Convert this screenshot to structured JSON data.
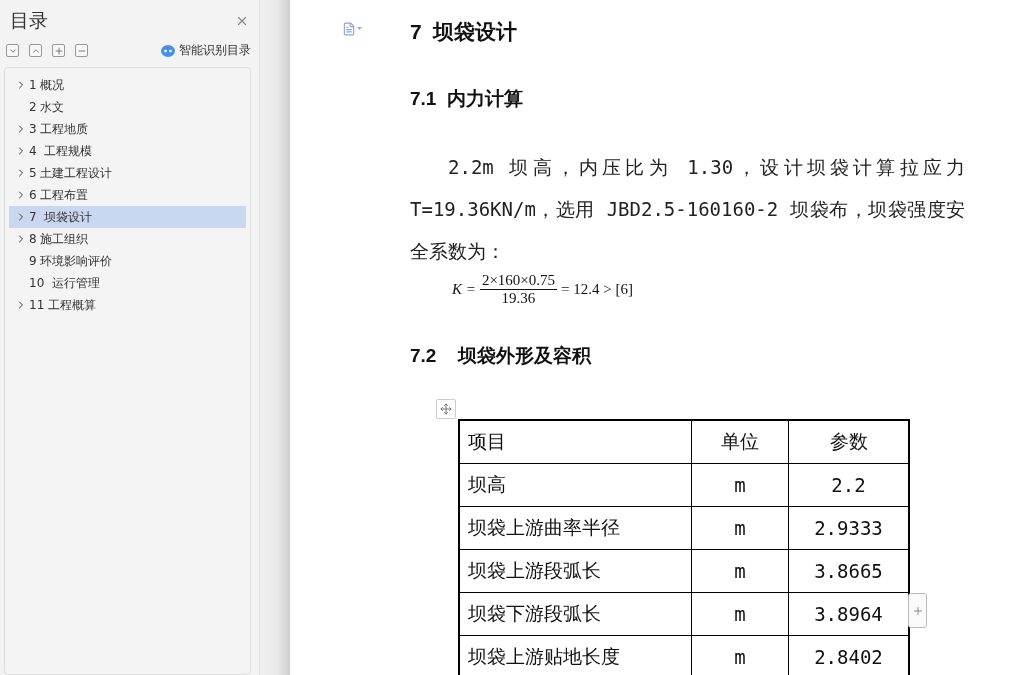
{
  "sidebar": {
    "title": "目录",
    "smart_button": "智能识别目录",
    "items": [
      {
        "label": "1 概况",
        "expandable": true,
        "selected": false
      },
      {
        "label": "2 水文",
        "expandable": false,
        "selected": false
      },
      {
        "label": "3 工程地质",
        "expandable": true,
        "selected": false
      },
      {
        "label": "4  工程规模",
        "expandable": true,
        "selected": false
      },
      {
        "label": "5 土建工程设计",
        "expandable": true,
        "selected": false
      },
      {
        "label": "6 工程布置",
        "expandable": true,
        "selected": false
      },
      {
        "label": "7  坝袋设计",
        "expandable": true,
        "selected": true
      },
      {
        "label": "8 施工组织",
        "expandable": true,
        "selected": false
      },
      {
        "label": "9 环境影响评价",
        "expandable": false,
        "selected": false
      },
      {
        "label": "10  运行管理",
        "expandable": false,
        "selected": false
      },
      {
        "label": "11 工程概算",
        "expandable": true,
        "selected": false
      }
    ]
  },
  "document": {
    "heading": "7  坝袋设计",
    "subheading_1": "7.1  内力计算",
    "paragraph": "2.2m 坝高，内压比为 1.30，设计坝袋计算拉应力 T=19.36KN/m，选用 JBD2.5-160160-2 坝袋布，坝袋强度安全系数为：",
    "formula": {
      "lhs": "K =",
      "numerator": "2×160×0.75",
      "denominator": "19.36",
      "rhs": "= 12.4 > [6]"
    },
    "subheading_2": "7.2    坝袋外形及容积",
    "table": {
      "columns": [
        "项目",
        "单位",
        "参数"
      ],
      "rows": [
        [
          "坝高",
          "m",
          "2.2"
        ],
        [
          "坝袋上游曲率半径",
          "m",
          "2.9333"
        ],
        [
          "坝袋上游段弧长",
          "m",
          "3.8665"
        ],
        [
          "坝袋下游段弧长",
          "m",
          "3.8964"
        ],
        [
          "坝袋上游贴地长度",
          "m",
          "2.8402"
        ]
      ]
    }
  }
}
